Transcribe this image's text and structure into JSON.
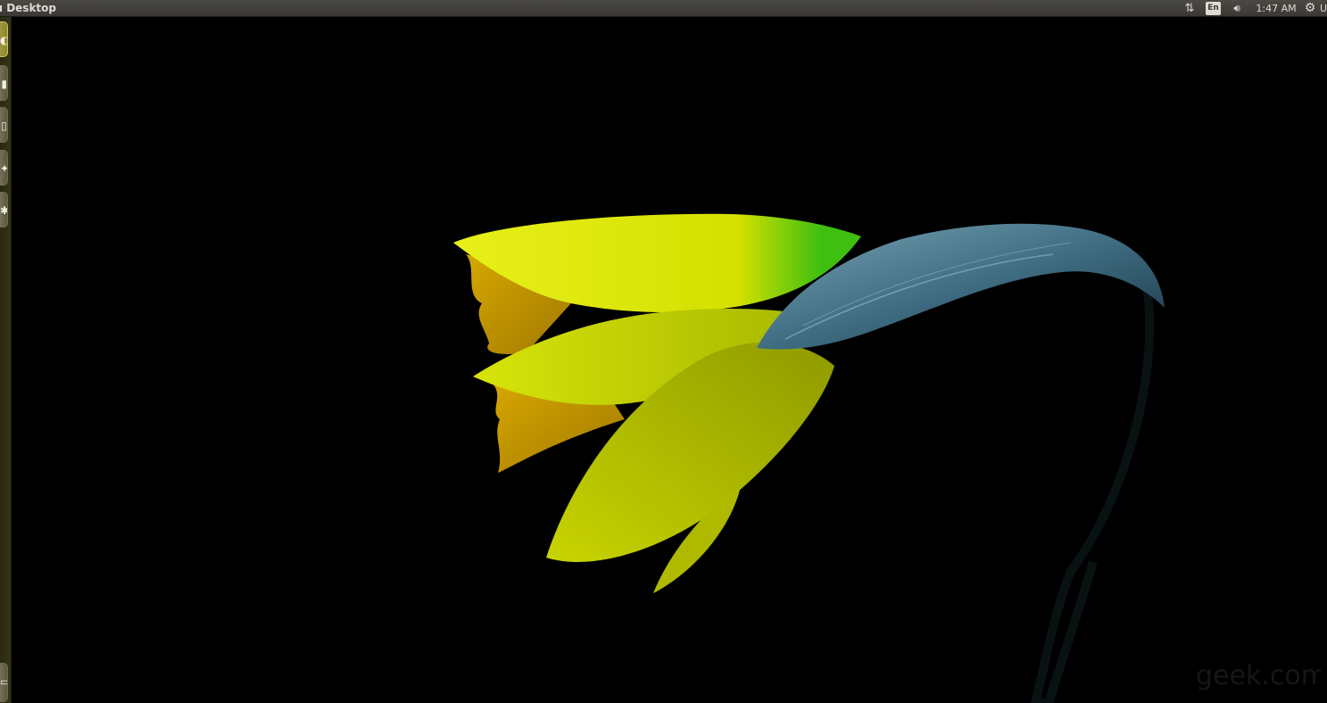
{
  "top_panel": {
    "app_title": "u Desktop",
    "indicators": {
      "network_icon": "network-updown-icon",
      "keyboard_layout": "En",
      "sound_icon": "speaker-icon",
      "clock": "1:47 AM",
      "session_icon": "gear-icon",
      "user_label": "U"
    }
  },
  "launcher": {
    "items": [
      {
        "name": "dash-home",
        "icon": "ubuntu-logo-icon"
      },
      {
        "name": "files",
        "icon": "folder-icon"
      },
      {
        "name": "browser",
        "icon": "window-icon"
      },
      {
        "name": "software-center",
        "icon": "bag-icon"
      },
      {
        "name": "system-settings",
        "icon": "gear-icon"
      },
      {
        "name": "trash",
        "icon": "trash-icon"
      }
    ]
  },
  "wallpaper": {
    "subject": "yellow-daffodil-on-black",
    "background_color": "#000000",
    "petal_color": "#d8e000",
    "stem_color": "#3c6b80",
    "watermark": "geek.com"
  }
}
